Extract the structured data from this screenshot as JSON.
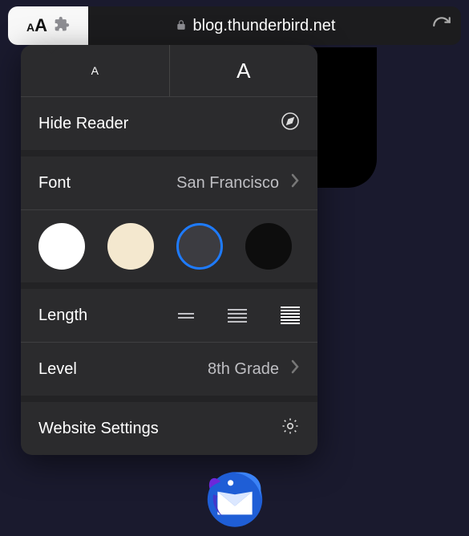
{
  "toolbar": {
    "url": "blog.thunderbird.net"
  },
  "popup": {
    "size_small": "A",
    "size_large": "A",
    "hide_reader": "Hide Reader",
    "font_label": "Font",
    "font_value": "San Francisco",
    "colors": {
      "white": "#ffffff",
      "sepia": "#f4e8cf",
      "gray": "#3c3c41",
      "black": "#0d0d0d",
      "selected": "gray"
    },
    "length_label": "Length",
    "level_label": "Level",
    "level_value": "8th Grade",
    "website_settings": "Website Settings"
  }
}
